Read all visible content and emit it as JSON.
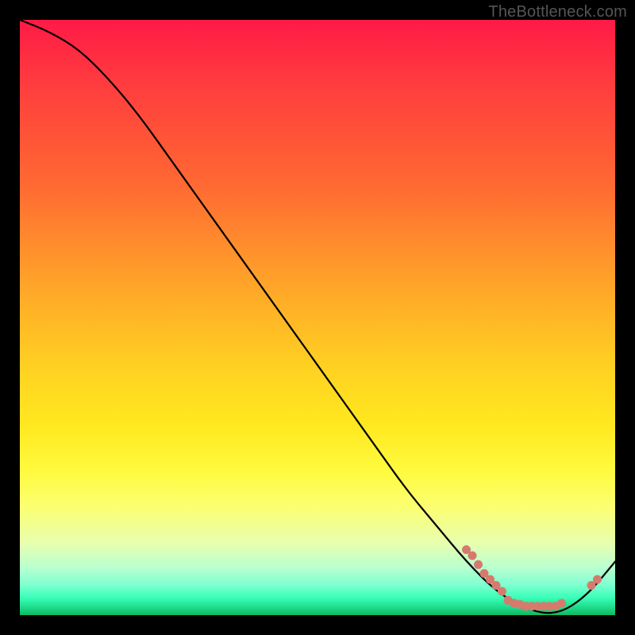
{
  "watermark": "TheBottleneck.com",
  "colors": {
    "gradient_top": "#ff1a46",
    "gradient_mid": "#ffe81f",
    "gradient_bottom": "#0fb860",
    "curve": "#000000",
    "dots": "#d67a6e",
    "frame": "#000000"
  },
  "chart_data": {
    "type": "line",
    "title": "",
    "xlabel": "",
    "ylabel": "",
    "xlim": [
      0,
      100
    ],
    "ylim": [
      0,
      100
    ],
    "x": [
      0,
      5,
      10,
      15,
      20,
      25,
      30,
      35,
      40,
      45,
      50,
      55,
      60,
      65,
      70,
      75,
      80,
      85,
      90,
      95,
      100
    ],
    "values": [
      100,
      98,
      95,
      90,
      84,
      77,
      70,
      63,
      56,
      49,
      42,
      35,
      28,
      21,
      15,
      9,
      4,
      1,
      0,
      3,
      9
    ],
    "grid": false,
    "legend": false,
    "dot_cluster": {
      "comment": "salmon data points along curve near minimum region",
      "points": [
        {
          "x": 75,
          "y": 11
        },
        {
          "x": 76,
          "y": 10
        },
        {
          "x": 77,
          "y": 8.5
        },
        {
          "x": 78,
          "y": 7
        },
        {
          "x": 79,
          "y": 6
        },
        {
          "x": 80,
          "y": 5
        },
        {
          "x": 81,
          "y": 4
        },
        {
          "x": 82,
          "y": 2.5
        },
        {
          "x": 83,
          "y": 2
        },
        {
          "x": 84,
          "y": 1.8
        },
        {
          "x": 85,
          "y": 1.5
        },
        {
          "x": 86,
          "y": 1.5
        },
        {
          "x": 87,
          "y": 1.5
        },
        {
          "x": 88,
          "y": 1.5
        },
        {
          "x": 89,
          "y": 1.5
        },
        {
          "x": 90,
          "y": 1.5
        },
        {
          "x": 91,
          "y": 2
        },
        {
          "x": 96,
          "y": 5
        },
        {
          "x": 97,
          "y": 6
        }
      ]
    }
  }
}
